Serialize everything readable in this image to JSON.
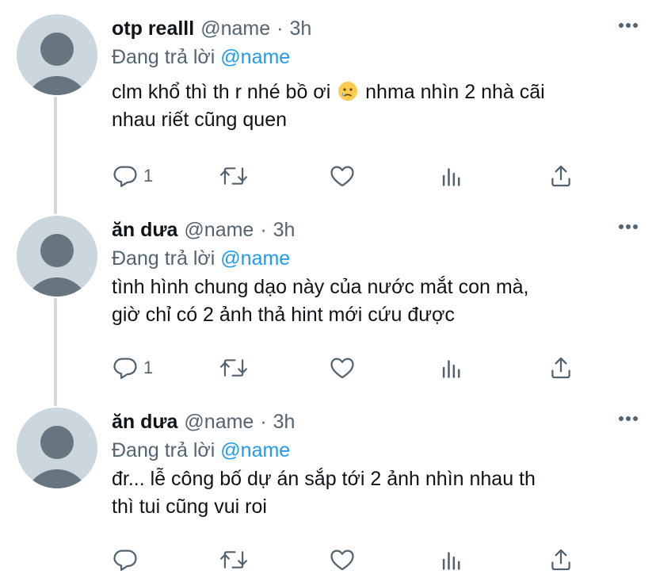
{
  "thread": {
    "tweets": [
      {
        "display_name": "otp realll",
        "handle": "@name",
        "time": "3h",
        "reply_prefix": "Đang trả lời",
        "reply_to": "@name",
        "text_before_emoji": "clm khổ thì th r nhé bồ ơi",
        "emoji": "crying-face-emoji",
        "text_after_emoji": " nhma nhìn 2 nhà cãi\nnhau riết cũng quen",
        "reply_count": "1"
      },
      {
        "display_name": "ăn dưa",
        "handle": "@name",
        "time": "3h",
        "reply_prefix": "Đang trả lời",
        "reply_to": "@name",
        "text": "tình hình chung dạo này của nước mắt con mà,\ngiờ chỉ có 2 ảnh thả hint mới cứu được",
        "reply_count": "1"
      },
      {
        "display_name": "ăn dưa",
        "handle": "@name",
        "time": "3h",
        "reply_prefix": "Đang trả lời",
        "reply_to": "@name",
        "text": "đr...  lễ công bố dự án sắp tới 2 ảnh nhìn nhau th\nthì tui cũng vui roi",
        "reply_count": ""
      }
    ]
  },
  "separator": "·",
  "icons": {
    "reply": "reply-icon",
    "retweet": "retweet-icon",
    "like": "like-icon",
    "views": "views-icon",
    "share": "share-icon",
    "more": "more-icon"
  },
  "colors": {
    "text": "#0f1419",
    "secondary": "#536471",
    "link": "#1d9bf0",
    "avatar_bg": "#ccd6dd",
    "avatar_fg": "#66757f",
    "thread_line": "#cfd9de"
  }
}
